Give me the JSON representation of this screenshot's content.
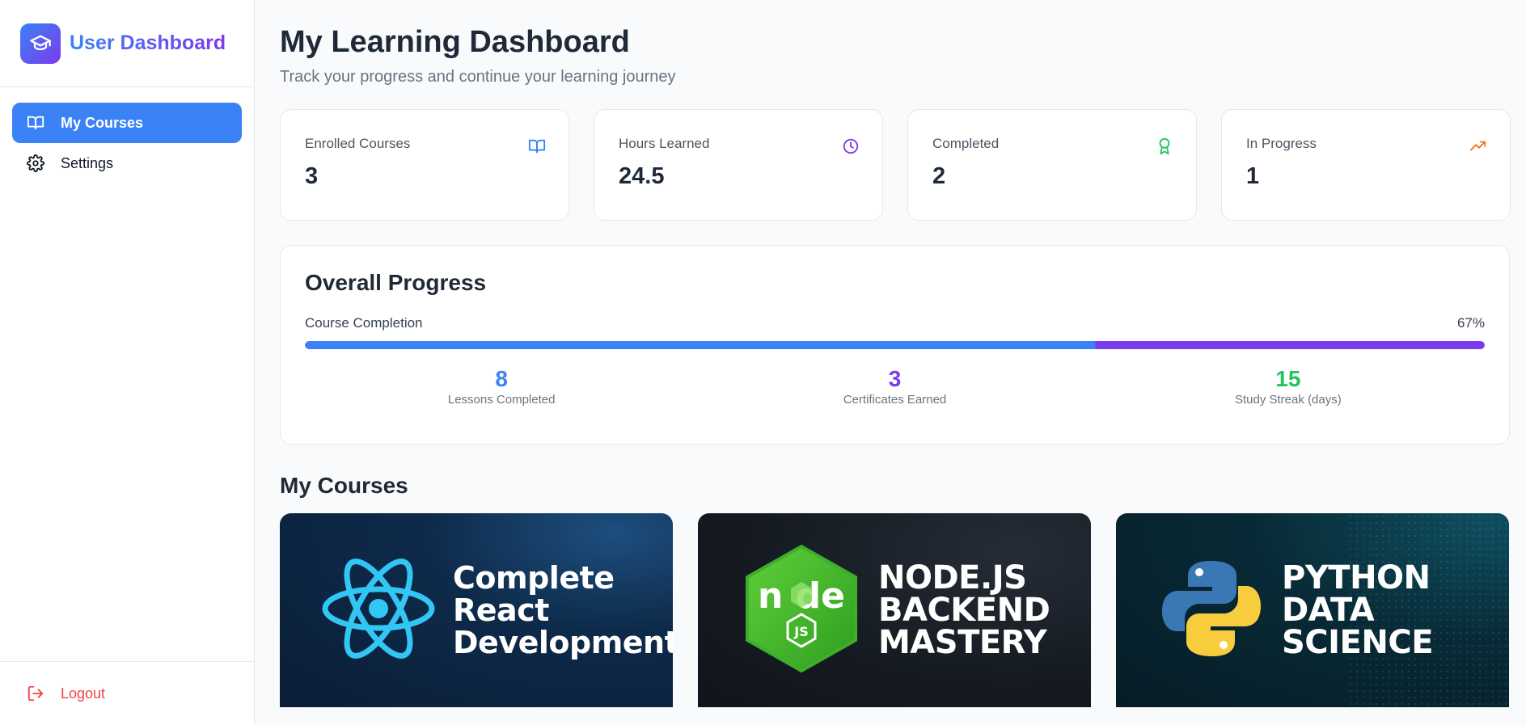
{
  "sidebar": {
    "brand": {
      "title": "User Dashboard",
      "icon": "graduation-cap-icon"
    },
    "items": [
      {
        "label": "My Courses",
        "icon": "book-open-icon",
        "active": true
      },
      {
        "label": "Settings",
        "icon": "gear-icon",
        "active": false
      }
    ],
    "logout": {
      "label": "Logout",
      "icon": "logout-icon"
    }
  },
  "header": {
    "title": "My Learning Dashboard",
    "subtitle": "Track your progress and continue your learning journey"
  },
  "stats": [
    {
      "label": "Enrolled Courses",
      "value": "3",
      "icon": "book-open-icon",
      "color": "#3b82f6"
    },
    {
      "label": "Hours Learned",
      "value": "24.5",
      "icon": "clock-icon",
      "color": "#7c3aed"
    },
    {
      "label": "Completed",
      "value": "2",
      "icon": "award-icon",
      "color": "#22c55e"
    },
    {
      "label": "In Progress",
      "value": "1",
      "icon": "trending-up-icon",
      "color": "#f97316"
    }
  ],
  "progress": {
    "title": "Overall Progress",
    "label": "Course Completion",
    "percent_text": "67%",
    "percent": 67,
    "colors": {
      "start": "#3b82f6",
      "end": "#7c3aed"
    },
    "metrics": [
      {
        "value": "8",
        "label": "Lessons Completed",
        "color": "#3b82f6"
      },
      {
        "value": "3",
        "label": "Certificates Earned",
        "color": "#7c3aed"
      },
      {
        "value": "15",
        "label": "Study Streak (days)",
        "color": "#22c55e"
      }
    ]
  },
  "courses_section": {
    "title": "My Courses",
    "courses": [
      {
        "title_lines": [
          "Complete",
          "React",
          "Development"
        ],
        "logo": "react-logo-icon"
      },
      {
        "title_lines": [
          "NODE.JS",
          "BACKEND",
          "MASTERY"
        ],
        "logo": "nodejs-logo-icon"
      },
      {
        "title_lines": [
          "PYTHON",
          "DATA",
          "SCIENCE"
        ],
        "logo": "python-logo-icon"
      }
    ]
  }
}
